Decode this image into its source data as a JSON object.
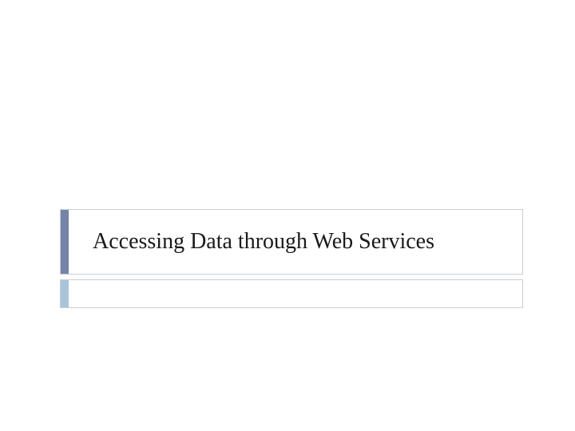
{
  "slide": {
    "title": "Accessing Data through Web Services",
    "subtitle": "",
    "colors": {
      "title_accent": "#7585a8",
      "subtitle_accent": "#a9c4da",
      "border": "#c9cdd3"
    }
  }
}
